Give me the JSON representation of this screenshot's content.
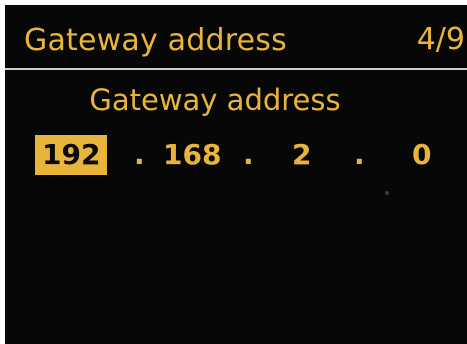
{
  "header": {
    "title": "Gateway address",
    "page_counter": "4/9"
  },
  "main": {
    "heading": "Gateway address",
    "ip_octets": [
      "192",
      "168",
      "2",
      "0"
    ],
    "separator": ".",
    "selected_octet_index": 0
  },
  "colors": {
    "screen_background": "#070707",
    "text_accent": "#e8b43a",
    "selection_background": "#e8b43a",
    "selection_text": "#0a0a0a",
    "divider": "#cfcfcf"
  }
}
